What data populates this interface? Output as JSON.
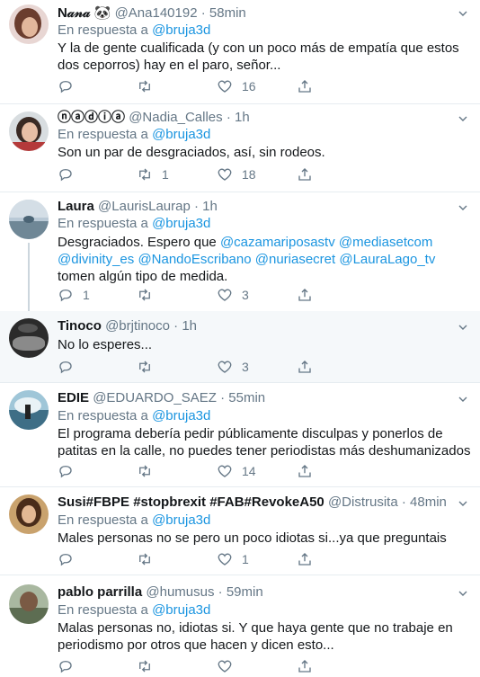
{
  "reply_prefix": "En respuesta a",
  "tweets": [
    {
      "name": "N𝒶𝓃𝒶 🐼",
      "handle": "@Ana140192",
      "dot": "·",
      "time": "58min",
      "reply_to": "@bruja3d",
      "text": "Y la de gente cualificada (y con un poco más de empatía que estos dos ceporros) hay en el paro, señor...",
      "replies": "",
      "retweets": "",
      "likes": "16"
    },
    {
      "name": "ⓝⓐⓓⓘⓐ",
      "handle": "@Nadia_Calles",
      "dot": "·",
      "time": "1h",
      "reply_to": "@bruja3d",
      "text": "Son un par de desgraciados, así, sin rodeos.",
      "replies": "",
      "retweets": "1",
      "likes": "18"
    },
    {
      "name": "Laura",
      "handle": "@LaurisLaurap",
      "dot": "·",
      "time": "1h",
      "reply_to": "@bruja3d",
      "text_parts": [
        "Desgraciados. Espero que ",
        "@cazamariposastv",
        " ",
        "@mediasetcom",
        " ",
        "@divinity_es",
        " ",
        "@NandoEscribano",
        " ",
        "@nuriasecret",
        " ",
        "@LauraLago_tv",
        " tomen algún tipo de medida."
      ],
      "replies": "1",
      "retweets": "",
      "likes": "3"
    },
    {
      "name": "Tinoco",
      "handle": "@brjtinoco",
      "dot": "·",
      "time": "1h",
      "text": "No lo esperes...",
      "replies": "",
      "retweets": "",
      "likes": "3"
    },
    {
      "name": "EDIE",
      "handle": "@EDUARDO_SAEZ",
      "dot": "·",
      "time": "55min",
      "reply_to": "@bruja3d",
      "text": "El programa debería pedir públicamente disculpas y ponerlos de patitas en la calle, no puedes tener periodistas más deshumanizados",
      "replies": "",
      "retweets": "",
      "likes": "14"
    },
    {
      "name": "Susi#FBPE #stopbrexit #FAB#RevokeA50",
      "handle": "@Distrusita",
      "dot": "·",
      "time": "48min",
      "reply_to": "@bruja3d",
      "text": "Males personas no se pero un poco idiotas si...ya que preguntais",
      "replies": "",
      "retweets": "",
      "likes": "1"
    },
    {
      "name": "pablo parrilla",
      "handle": "@humusus",
      "dot": "·",
      "time": "59min",
      "reply_to": "@bruja3d",
      "text": "Malas personas no, idiotas si. Y que haya gente que no trabaje en periodismo por otros que hacen y dicen esto...",
      "replies": "",
      "retweets": "",
      "likes": ""
    }
  ],
  "colors": {
    "link": "#1b95e0",
    "muted": "#657786",
    "text": "#14171a",
    "divider": "#e6ecf0",
    "highlight": "#f5f8fa"
  },
  "icons": {
    "reply": "reply-icon",
    "retweet": "retweet-icon",
    "like": "heart-icon",
    "share": "share-icon",
    "more": "chevron-down-icon"
  }
}
